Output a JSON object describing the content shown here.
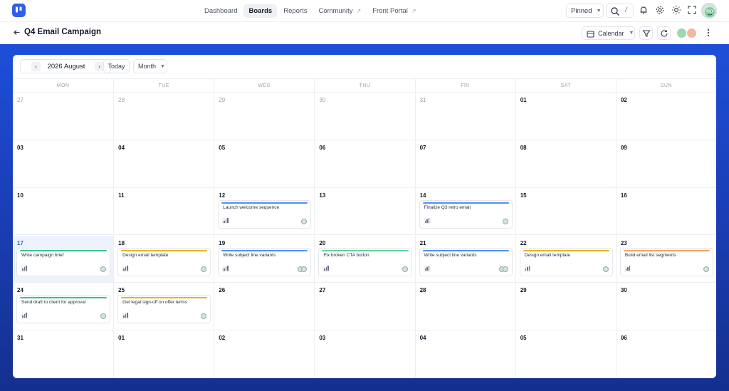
{
  "nav": {
    "links": [
      {
        "label": "Dashboard",
        "active": false,
        "external": false
      },
      {
        "label": "Boards",
        "active": true,
        "external": false
      },
      {
        "label": "Reports",
        "active": false,
        "external": false
      },
      {
        "label": "Community",
        "active": false,
        "external": true
      },
      {
        "label": "Front Portal",
        "active": false,
        "external": true
      }
    ],
    "external_glyph": "↗",
    "pinned_label": "Pinned",
    "search_shortcut": "/",
    "icons": [
      "search-icon",
      "bell-icon",
      "gear-icon",
      "sun-icon",
      "fullscreen-icon"
    ]
  },
  "page": {
    "back_glyph": "←",
    "title": "Q4 Email Campaign",
    "view_label": "Calendar",
    "icons": [
      "calendar-icon",
      "filter-icon",
      "refresh-icon",
      "more-vertical-icon"
    ]
  },
  "calendar": {
    "month_label": "2026 August",
    "prev_glyph": "‹",
    "next_glyph": "›",
    "today_label": "Today",
    "mode_label": "Month",
    "weekdays": [
      "MON",
      "TUE",
      "WED",
      "THU",
      "FRI",
      "SAT",
      "SUN"
    ],
    "weeks": [
      [
        {
          "d": "27",
          "out": true
        },
        {
          "d": "28",
          "out": true
        },
        {
          "d": "29",
          "out": true
        },
        {
          "d": "30",
          "out": true
        },
        {
          "d": "31",
          "out": true
        },
        {
          "d": "01"
        },
        {
          "d": "02"
        }
      ],
      [
        {
          "d": "03"
        },
        {
          "d": "04"
        },
        {
          "d": "05"
        },
        {
          "d": "06"
        },
        {
          "d": "07"
        },
        {
          "d": "08"
        },
        {
          "d": "09"
        }
      ],
      [
        {
          "d": "10"
        },
        {
          "d": "11"
        },
        {
          "d": "12",
          "task": {
            "title": "Launch welcome sequence",
            "color": "#4f8ff7",
            "avatars": 1
          }
        },
        {
          "d": "13"
        },
        {
          "d": "14",
          "task": {
            "title": "Finalize Q3 retro email",
            "color": "#4f8ff7",
            "avatars": 1
          }
        },
        {
          "d": "15"
        },
        {
          "d": "16"
        }
      ],
      [
        {
          "d": "17",
          "today": true,
          "task": {
            "title": "Write campaign brief",
            "color": "#34c38f",
            "avatars": 1
          }
        },
        {
          "d": "18",
          "task": {
            "title": "Design email template",
            "color": "#e6b422",
            "avatars": 1
          }
        },
        {
          "d": "19",
          "task": {
            "title": "Write subject line variants",
            "color": "#4f8ff7",
            "avatars": 2
          }
        },
        {
          "d": "20",
          "task": {
            "title": "Fix broken CTA button",
            "color": "#5fd39b",
            "avatars": 1
          }
        },
        {
          "d": "21",
          "task": {
            "title": "Write subject line variants",
            "color": "#4f8ff7",
            "avatars": 2
          }
        },
        {
          "d": "22",
          "task": {
            "title": "Design email template",
            "color": "#e6b422",
            "avatars": 1
          }
        },
        {
          "d": "23",
          "task": {
            "title": "Build email list segments",
            "color": "#f4a261",
            "avatars": 1
          }
        }
      ],
      [
        {
          "d": "24",
          "task": {
            "title": "Send draft to client for approval",
            "color": "#34c38f",
            "avatars": 1
          }
        },
        {
          "d": "25",
          "task": {
            "title": "Get legal sign-off on offer terms",
            "color": "#e6b422",
            "avatars": 1
          }
        },
        {
          "d": "26"
        },
        {
          "d": "27"
        },
        {
          "d": "28"
        },
        {
          "d": "29"
        },
        {
          "d": "30"
        }
      ],
      [
        {
          "d": "31"
        },
        {
          "d": "01",
          "out": false
        },
        {
          "d": "02"
        },
        {
          "d": "03"
        },
        {
          "d": "04"
        },
        {
          "d": "05"
        },
        {
          "d": "06"
        }
      ]
    ]
  },
  "colors": {
    "accent": "#2f5fe8",
    "backdrop_top": "#1d4fd8",
    "backdrop_bottom": "#14308e",
    "today_bg": "#eef2fd"
  }
}
